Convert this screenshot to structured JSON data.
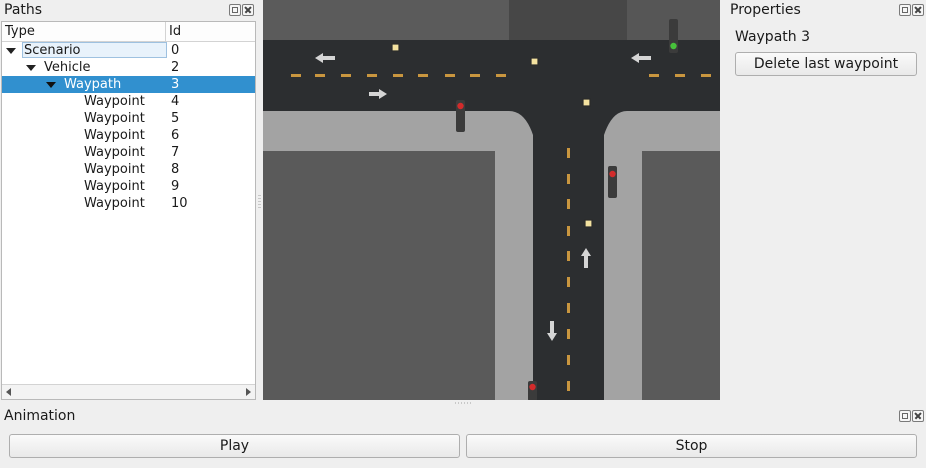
{
  "paths_dock": {
    "title": "Paths",
    "columns": {
      "type": "Type",
      "id": "Id"
    },
    "rows": [
      {
        "name": "Scenario",
        "id": "0"
      },
      {
        "name": "Vehicle",
        "id": "2"
      },
      {
        "name": "Waypath",
        "id": "3"
      },
      {
        "name": "Waypoint",
        "id": "4"
      },
      {
        "name": "Waypoint",
        "id": "5"
      },
      {
        "name": "Waypoint",
        "id": "6"
      },
      {
        "name": "Waypoint",
        "id": "7"
      },
      {
        "name": "Waypoint",
        "id": "8"
      },
      {
        "name": "Waypoint",
        "id": "9"
      },
      {
        "name": "Waypoint",
        "id": "10"
      }
    ],
    "selected_row": "Waypath"
  },
  "properties_dock": {
    "title": "Properties",
    "selection_label": "Waypath 3",
    "delete_button": "Delete last waypoint"
  },
  "animation_dock": {
    "title": "Animation",
    "play_button": "Play",
    "stop_button": "Stop"
  },
  "map": {
    "traffic_lights": [
      {
        "state": "green",
        "color": "#47c13b"
      },
      {
        "state": "red",
        "color": "#d22b2b"
      },
      {
        "state": "red",
        "color": "#d22b2b"
      },
      {
        "state": "red",
        "color": "#d22b2b"
      }
    ],
    "lane_marking_color": "#c9963f",
    "waypoint_marker_color": "#f4e2a0"
  }
}
